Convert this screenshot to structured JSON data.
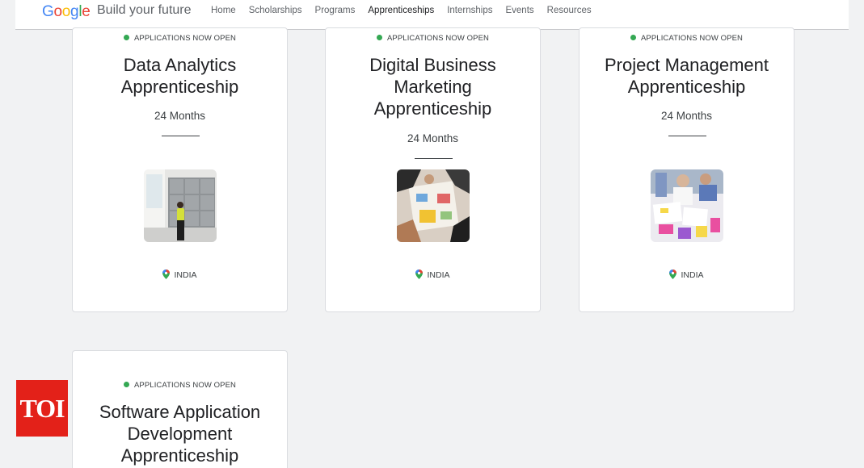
{
  "header": {
    "logo": {
      "letters": [
        "G",
        "o",
        "o",
        "g",
        "l",
        "e"
      ],
      "colors": [
        "#4285f4",
        "#ea4335",
        "#fbbc05",
        "#4285f4",
        "#34a853",
        "#ea4335"
      ]
    },
    "title": "Build your future",
    "nav": [
      "Home",
      "Scholarships",
      "Programs",
      "Apprenticeships",
      "Internships",
      "Events",
      "Resources"
    ],
    "active_nav": "Apprenticeships"
  },
  "cards": [
    {
      "status": "APPLICATIONS NOW OPEN",
      "title": "Data Analytics Apprenticeship",
      "duration": "24 Months",
      "location": "INDIA",
      "image": "presenter-photo"
    },
    {
      "status": "APPLICATIONS NOW OPEN",
      "title": "Digital Business Marketing Apprenticeship",
      "duration": "24 Months",
      "location": "INDIA",
      "image": "team-workshop-photo"
    },
    {
      "status": "APPLICATIONS NOW OPEN",
      "title": "Project Management Apprenticeship",
      "duration": "24 Months",
      "location": "INDIA",
      "image": "planning-session-photo"
    },
    {
      "status": "APPLICATIONS NOW OPEN",
      "title": "Software Application Development Apprenticeship"
    }
  ],
  "watermark": "TOI",
  "colors": {
    "status_dot": "#34a853",
    "active_underline": "#1a73e8",
    "toi_red": "#e32119"
  }
}
